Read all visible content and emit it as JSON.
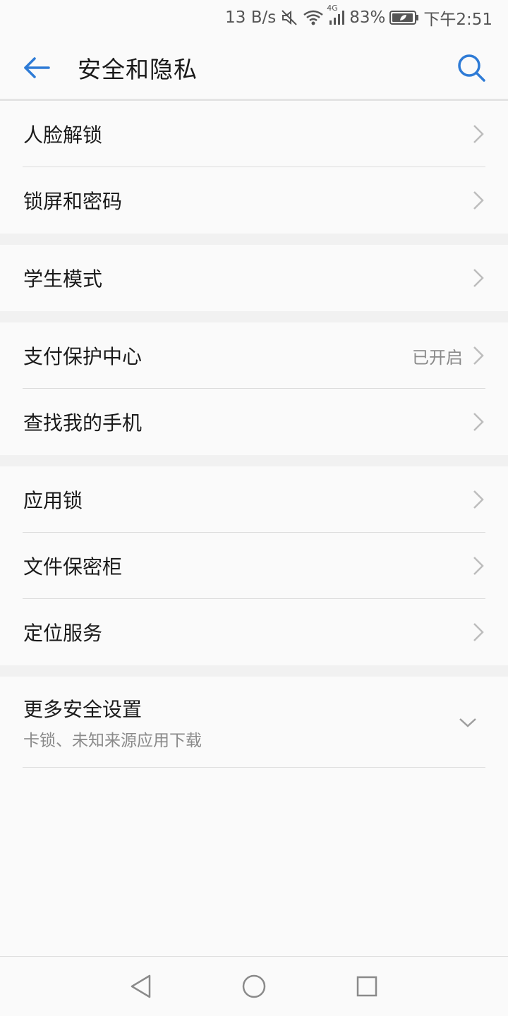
{
  "status_bar": {
    "net_speed": "13 B/s",
    "network_type": "4G",
    "battery": "83%",
    "time": "下午2:51",
    "icons": [
      "mute-icon",
      "wifi-icon",
      "signal-icon",
      "battery-icon"
    ]
  },
  "header": {
    "title": "安全和隐私",
    "back_icon": "back-arrow-icon",
    "search_icon": "search-icon",
    "accent_color": "#2e7bd6"
  },
  "groups": [
    {
      "items": [
        {
          "label": "人脸解锁"
        },
        {
          "label": "锁屏和密码"
        }
      ]
    },
    {
      "items": [
        {
          "label": "学生模式"
        }
      ]
    },
    {
      "items": [
        {
          "label": "支付保护中心",
          "value": "已开启"
        },
        {
          "label": "查找我的手机"
        }
      ]
    },
    {
      "items": [
        {
          "label": "应用锁"
        },
        {
          "label": "文件保密柜"
        },
        {
          "label": "定位服务"
        }
      ]
    },
    {
      "items": [
        {
          "label": "更多安全设置",
          "subtitle": "卡锁、未知来源应用下载",
          "icon": "chevron-down-icon"
        }
      ]
    }
  ],
  "nav_bar": {
    "buttons": [
      "back-triangle-icon",
      "home-circle-icon",
      "recents-square-icon"
    ]
  }
}
